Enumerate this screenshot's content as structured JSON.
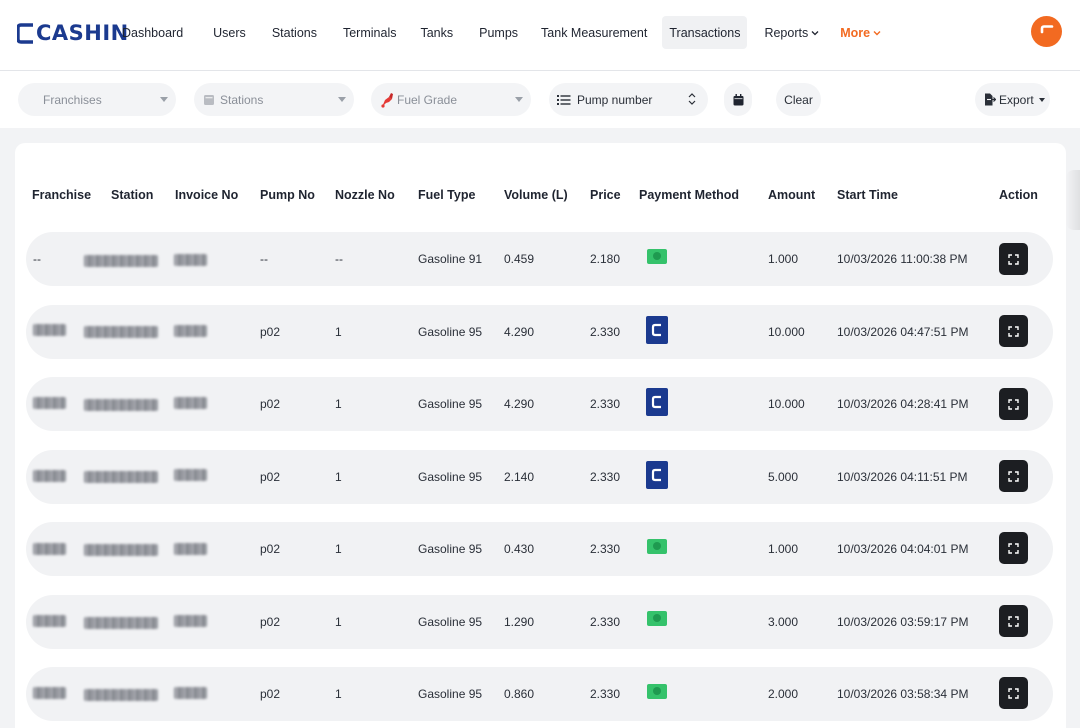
{
  "brand": {
    "name": "CASHIN",
    "color": "#1b3a8f",
    "accent": "#f26a21"
  },
  "nav": {
    "items": [
      {
        "label": "Dashboard"
      },
      {
        "label": "Users"
      },
      {
        "label": "Stations"
      },
      {
        "label": "Terminals"
      },
      {
        "label": "Tanks"
      },
      {
        "label": "Pumps"
      },
      {
        "label": "Tank Measurement"
      },
      {
        "label": "Transactions",
        "active": true
      },
      {
        "label": "Reports",
        "dropdown": true
      },
      {
        "label": "More",
        "dropdown": true
      }
    ]
  },
  "filters": {
    "franchises_placeholder": "Franchises",
    "stations_placeholder": "Stations",
    "fuel_grade_placeholder": "Fuel Grade",
    "pump_number_placeholder": "Pump number",
    "clear_label": "Clear",
    "export_label": "Export"
  },
  "table": {
    "columns": [
      "Franchise",
      "Station",
      "Invoice No",
      "Pump No",
      "Nozzle No",
      "Fuel Type",
      "Volume (L)",
      "Price",
      "Payment Method",
      "Amount",
      "Start Time",
      "Action"
    ],
    "rows": [
      {
        "franchise": "--",
        "pump_no": "--",
        "nozzle_no": "--",
        "fuel_type": "Gasoline 91",
        "volume": "0.459",
        "price": "2.180",
        "payment": "cash",
        "amount": "1.000",
        "start_time": "10/03/2026 11:00:38 PM"
      },
      {
        "franchise": "",
        "pump_no": "p02",
        "nozzle_no": "1",
        "fuel_type": "Gasoline 95",
        "volume": "4.290",
        "price": "2.330",
        "payment": "cashin",
        "amount": "10.000",
        "start_time": "10/03/2026 04:47:51 PM"
      },
      {
        "franchise": "",
        "pump_no": "p02",
        "nozzle_no": "1",
        "fuel_type": "Gasoline 95",
        "volume": "4.290",
        "price": "2.330",
        "payment": "cashin",
        "amount": "10.000",
        "start_time": "10/03/2026 04:28:41 PM"
      },
      {
        "franchise": "",
        "pump_no": "p02",
        "nozzle_no": "1",
        "fuel_type": "Gasoline 95",
        "volume": "2.140",
        "price": "2.330",
        "payment": "cashin",
        "amount": "5.000",
        "start_time": "10/03/2026 04:11:51 PM"
      },
      {
        "franchise": "",
        "pump_no": "p02",
        "nozzle_no": "1",
        "fuel_type": "Gasoline 95",
        "volume": "0.430",
        "price": "2.330",
        "payment": "cash",
        "amount": "1.000",
        "start_time": "10/03/2026 04:04:01 PM"
      },
      {
        "franchise": "",
        "pump_no": "p02",
        "nozzle_no": "1",
        "fuel_type": "Gasoline 95",
        "volume": "1.290",
        "price": "2.330",
        "payment": "cash",
        "amount": "3.000",
        "start_time": "10/03/2026 03:59:17 PM"
      },
      {
        "franchise": "",
        "pump_no": "p02",
        "nozzle_no": "1",
        "fuel_type": "Gasoline 95",
        "volume": "0.860",
        "price": "2.330",
        "payment": "cash",
        "amount": "2.000",
        "start_time": "10/03/2026 03:58:34 PM"
      }
    ]
  }
}
